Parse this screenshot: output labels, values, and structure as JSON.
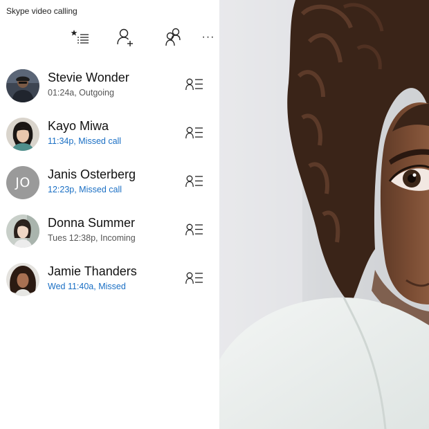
{
  "app": {
    "title": "Skype video calling"
  },
  "toolbar": {
    "buttons": [
      {
        "name": "favorites-list",
        "icon": "star-list-icon"
      },
      {
        "name": "add-contact",
        "icon": "add-person-icon"
      },
      {
        "name": "group",
        "icon": "people-icon"
      },
      {
        "name": "more",
        "icon": "more-icon",
        "label": "···"
      }
    ]
  },
  "contacts": [
    {
      "name": "Stevie Wonder",
      "status": "01:24a, Outgoing",
      "missed": false,
      "avatar": "photo"
    },
    {
      "name": "Kayo Miwa",
      "status": "11:34p, Missed call",
      "missed": true,
      "avatar": "photo"
    },
    {
      "name": "Janis Osterberg",
      "status": "12:23p, Missed call",
      "missed": true,
      "avatar": "initials",
      "initials": "JO"
    },
    {
      "name": "Donna Summer",
      "status": "Tues 12:38p, Incoming",
      "missed": false,
      "avatar": "photo"
    },
    {
      "name": "Jamie Thanders",
      "status": "Wed 11:40a, Missed",
      "missed": true,
      "avatar": "photo"
    }
  ],
  "colors": {
    "missed_text": "#1a6fc4",
    "normal_status_text": "#555555",
    "initials_avatar_bg": "#9a9a9a",
    "icon": "#222222"
  }
}
